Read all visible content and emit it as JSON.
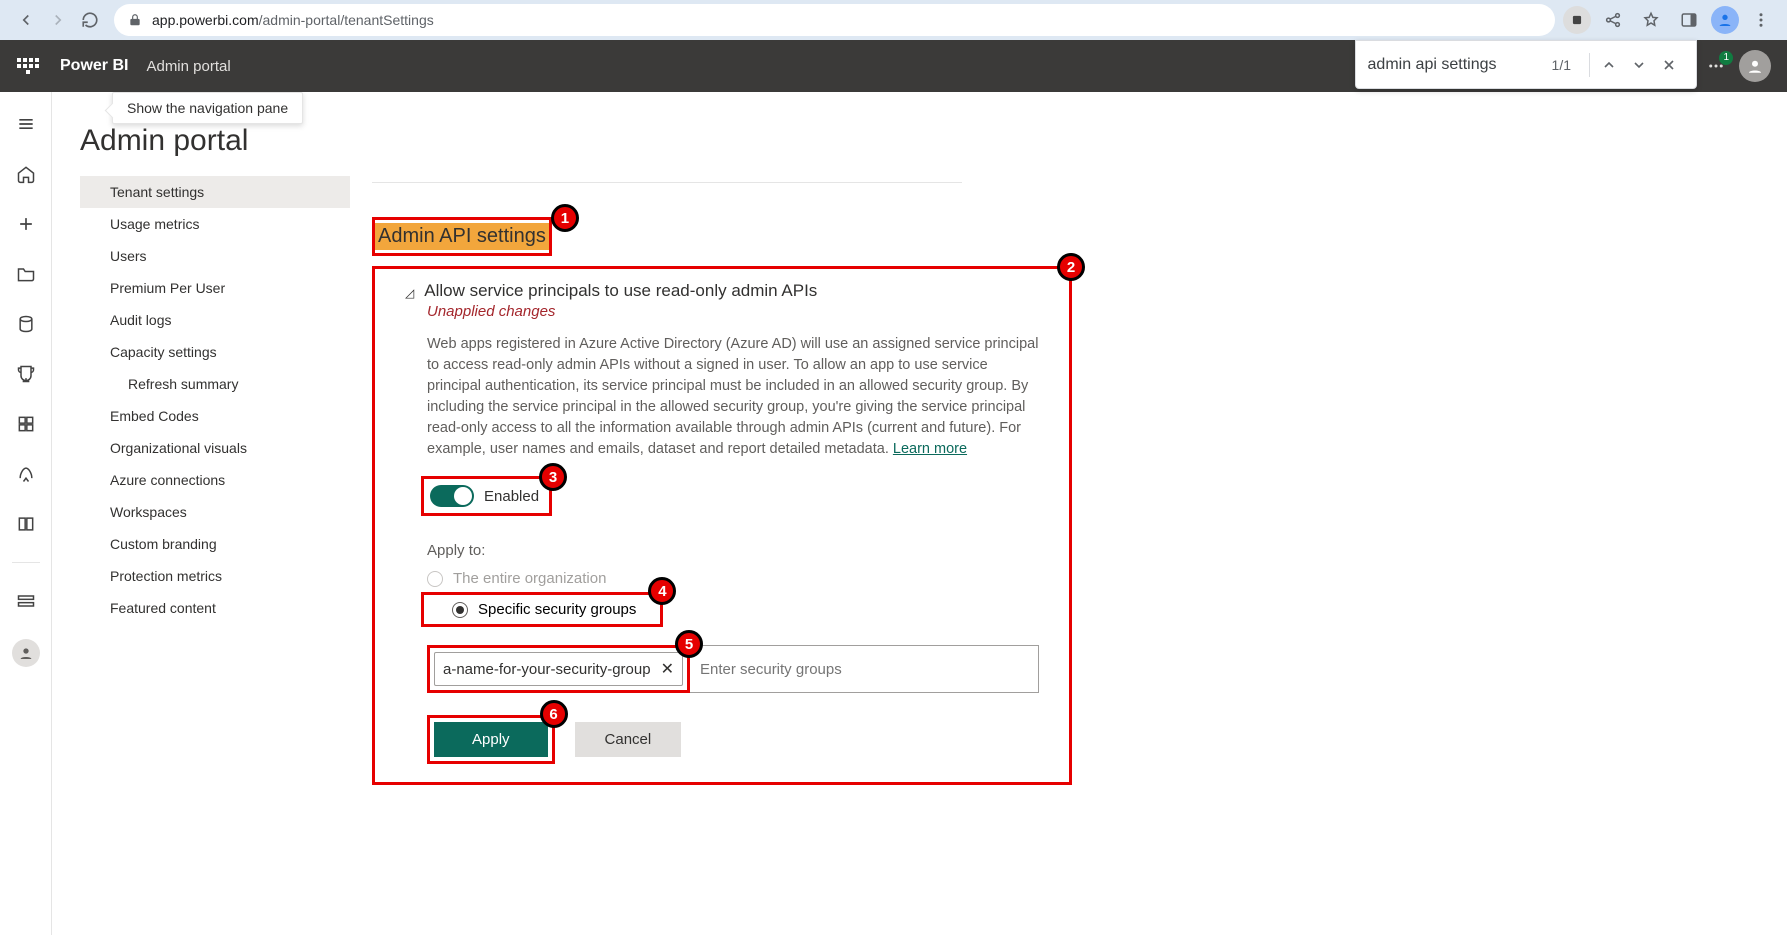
{
  "browser": {
    "url_host": "app.powerbi.com",
    "url_path": "/admin-portal/tenantSettings"
  },
  "find": {
    "query": "admin api settings",
    "count": "1/1"
  },
  "topbar": {
    "brand": "Power BI",
    "section": "Admin portal",
    "notif_count": "1"
  },
  "tooltip": "Show the navigation pane",
  "page_title": "Admin portal",
  "nav": {
    "items": [
      "Tenant settings",
      "Usage metrics",
      "Users",
      "Premium Per User",
      "Audit logs",
      "Capacity settings",
      "Refresh summary",
      "Embed Codes",
      "Organizational visuals",
      "Azure connections",
      "Workspaces",
      "Custom branding",
      "Protection metrics",
      "Featured content"
    ]
  },
  "section_heading": "Admin API settings",
  "setting": {
    "title": "Allow service principals to use read-only admin APIs",
    "unapplied": "Unapplied changes",
    "description": "Web apps registered in Azure Active Directory (Azure AD) will use an assigned service principal to access read-only admin APIs without a signed in user. To allow an app to use service principal authentication, its service principal must be included in an allowed security group. By including the service principal in the allowed security group, you're giving the service principal read-only access to all the information available through admin APIs (current and future). For example, user names and emails, dataset and report detailed metadata. ",
    "learn_more": "Learn more",
    "toggle_label": "Enabled",
    "apply_to_label": "Apply to:",
    "radio_entire": "The entire organization",
    "radio_specific": "Specific security groups",
    "chip": "a-name-for-your-security-group",
    "sg_placeholder": "Enter security groups",
    "apply": "Apply",
    "cancel": "Cancel"
  },
  "annotations": {
    "n1": "1",
    "n2": "2",
    "n3": "3",
    "n4": "4",
    "n5": "5",
    "n6": "6"
  }
}
